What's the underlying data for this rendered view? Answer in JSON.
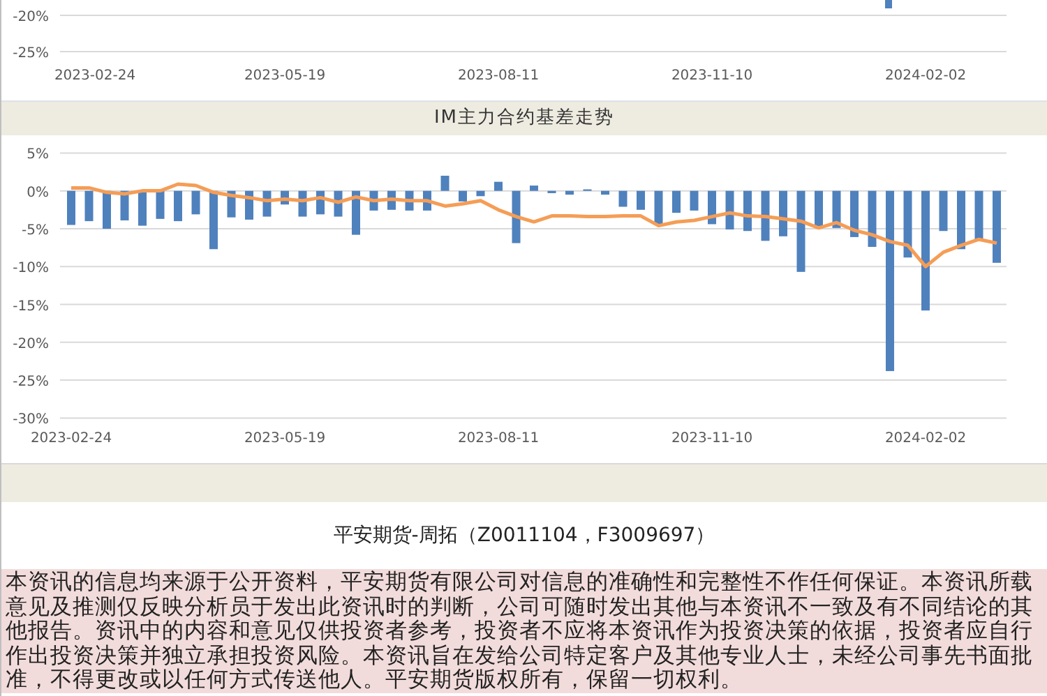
{
  "top_chart": {
    "y_axis_labels": [
      "-20%",
      "-25%"
    ],
    "x_axis_labels": [
      "2023-02-24",
      "2023-05-19",
      "2023-08-11",
      "2023-11-10",
      "2024-02-02"
    ]
  },
  "basis_chart": {
    "chart_data": {
      "type": "bar",
      "title": "IM主力合约基差走势",
      "categories": [
        "2023-02-24",
        null,
        null,
        null,
        null,
        null,
        null,
        null,
        null,
        null,
        null,
        null,
        "2023-05-19",
        null,
        null,
        null,
        null,
        null,
        null,
        null,
        null,
        null,
        null,
        null,
        "2023-08-11",
        null,
        null,
        null,
        null,
        null,
        null,
        null,
        null,
        null,
        null,
        null,
        "2023-11-10",
        null,
        null,
        null,
        null,
        null,
        null,
        null,
        null,
        null,
        null,
        null,
        "2024-02-02",
        null,
        null,
        null,
        null
      ],
      "ylim": [
        -30,
        5
      ],
      "grid": true,
      "yticks": [
        {
          "value": 5,
          "label": "5%"
        },
        {
          "value": 0,
          "label": "0%"
        },
        {
          "value": -5,
          "label": "-5%"
        },
        {
          "value": -10,
          "label": "-10%"
        },
        {
          "value": -15,
          "label": "-15%"
        },
        {
          "value": -20,
          "label": "-20%"
        },
        {
          "value": -25,
          "label": "-25%"
        },
        {
          "value": -30,
          "label": "-30%"
        }
      ],
      "series": [
        {
          "color": "#4f81bd",
          "values": [
            -4.5,
            -4.0,
            -5.0,
            -3.9,
            -4.6,
            -3.7,
            -4.0,
            -3.1,
            -7.7,
            -3.5,
            -3.8,
            -3.4,
            -1.8,
            -3.4,
            -3.1,
            -3.4,
            -5.8,
            -2.6,
            -2.5,
            -2.6,
            -2.6,
            2.0,
            -1.4,
            -0.7,
            1.2,
            -6.9,
            0.7,
            -0.3,
            -0.5,
            0.2,
            -0.5,
            -2.1,
            -2.5,
            -4.4,
            -2.9,
            -2.6,
            -4.4,
            -5.1,
            -5.3,
            -6.6,
            -6.0,
            -10.7,
            -4.7,
            -4.9,
            -6.1,
            -7.4,
            -23.8,
            -8.8,
            -15.8,
            -5.3,
            -7.7,
            -6.4,
            -9.5
          ]
        },
        {
          "type": "line",
          "color": "#f59d56",
          "values": [
            0.4,
            0.4,
            -0.2,
            -0.4,
            0,
            0,
            0.9,
            0.7,
            -0.2,
            -0.6,
            -0.9,
            -1.3,
            -1.1,
            -1.3,
            -0.9,
            -1.5,
            -0.8,
            -1.3,
            -1.1,
            -1.3,
            -1.3,
            -2.0,
            -1.7,
            -1.3,
            -2.5,
            -3.4,
            -4.1,
            -3.3,
            -3.3,
            -3.4,
            -3.4,
            -3.3,
            -3.3,
            -4.6,
            -4.1,
            -3.9,
            -3.4,
            -2.9,
            -3.3,
            -3.4,
            -3.7,
            -4.0,
            -4.9,
            -4.2,
            -5.2,
            -5.8,
            -6.7,
            -7.2,
            -10.0,
            -8.1,
            -7.2,
            -6.4,
            -6.9
          ]
        }
      ]
    }
  },
  "author_line": "平安期货-周拓（Z0011104，F3009697）",
  "disclaimer": "本资讯的信息均来源于公开资料，平安期货有限公司对信息的准确性和完整性不作任何保证。本资讯所载意见及推测仅反映分析员于发出此资讯时的判断，公司可随时发出其他与本资讯不一致及有不同结论的其他报告。资讯中的内容和意见仅供投资者参考，投资者不应将本资讯作为投资决策的依据，投资者应自行作出投资决策并独立承担投资风险。本资讯旨在发给公司特定客户及其他专业人士，未经公司事先书面批准，不得更改或以任何方式传送他人。平安期货版权所有，保留一切权利。"
}
